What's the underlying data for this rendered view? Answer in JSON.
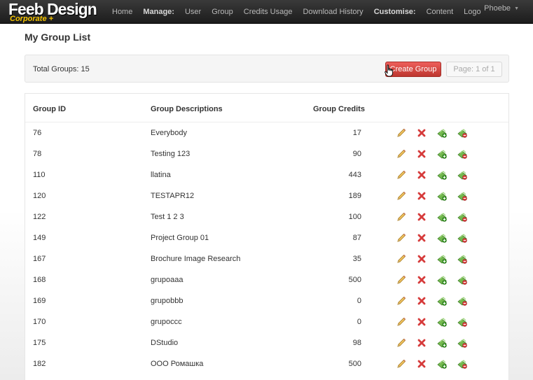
{
  "navbar": {
    "brand": "Feeb Design",
    "brand_sub": "Corporate +",
    "home": "Home",
    "manage_label": "Manage:",
    "user": "User",
    "group": "Group",
    "credits_usage": "Credits Usage",
    "download_history": "Download History",
    "customise_label": "Customise:",
    "content": "Content",
    "logo": "Logo",
    "user_menu": "Phoebe"
  },
  "page": {
    "title": "My Group List"
  },
  "toolbar": {
    "total_label": "Total Groups: 15",
    "create_label": "Create Group",
    "pager_label": "Page: 1 of 1"
  },
  "table": {
    "headers": {
      "id": "Group ID",
      "desc": "Group Descriptions",
      "credits": "Group Credits"
    },
    "rows": [
      {
        "id": "76",
        "desc": "Everybody",
        "credits": "17"
      },
      {
        "id": "78",
        "desc": "Testing 123",
        "credits": "90"
      },
      {
        "id": "110",
        "desc": "llatina",
        "credits": "443"
      },
      {
        "id": "120",
        "desc": "TESTAPR12",
        "credits": "189"
      },
      {
        "id": "122",
        "desc": "Test 1 2 3",
        "credits": "100"
      },
      {
        "id": "149",
        "desc": "Project Group 01",
        "credits": "87"
      },
      {
        "id": "167",
        "desc": "Brochure Image Research",
        "credits": "35"
      },
      {
        "id": "168",
        "desc": "grupoaaa",
        "credits": "500"
      },
      {
        "id": "169",
        "desc": "grupobbb",
        "credits": "0"
      },
      {
        "id": "170",
        "desc": "grupoccc",
        "credits": "0"
      },
      {
        "id": "175",
        "desc": "DStudio",
        "credits": "98"
      },
      {
        "id": "182",
        "desc": "ООО Ромашка",
        "credits": "500"
      }
    ],
    "action_icons": [
      "pencil-icon",
      "delete-x-icon",
      "add-credit-icon",
      "remove-credit-icon"
    ]
  },
  "colors": {
    "navbar": "#222222",
    "create_button": "#d9433d",
    "edit_icon": "#e0b04a",
    "delete_icon": "#d63b3b",
    "credit_icon": "#5aa83c"
  }
}
